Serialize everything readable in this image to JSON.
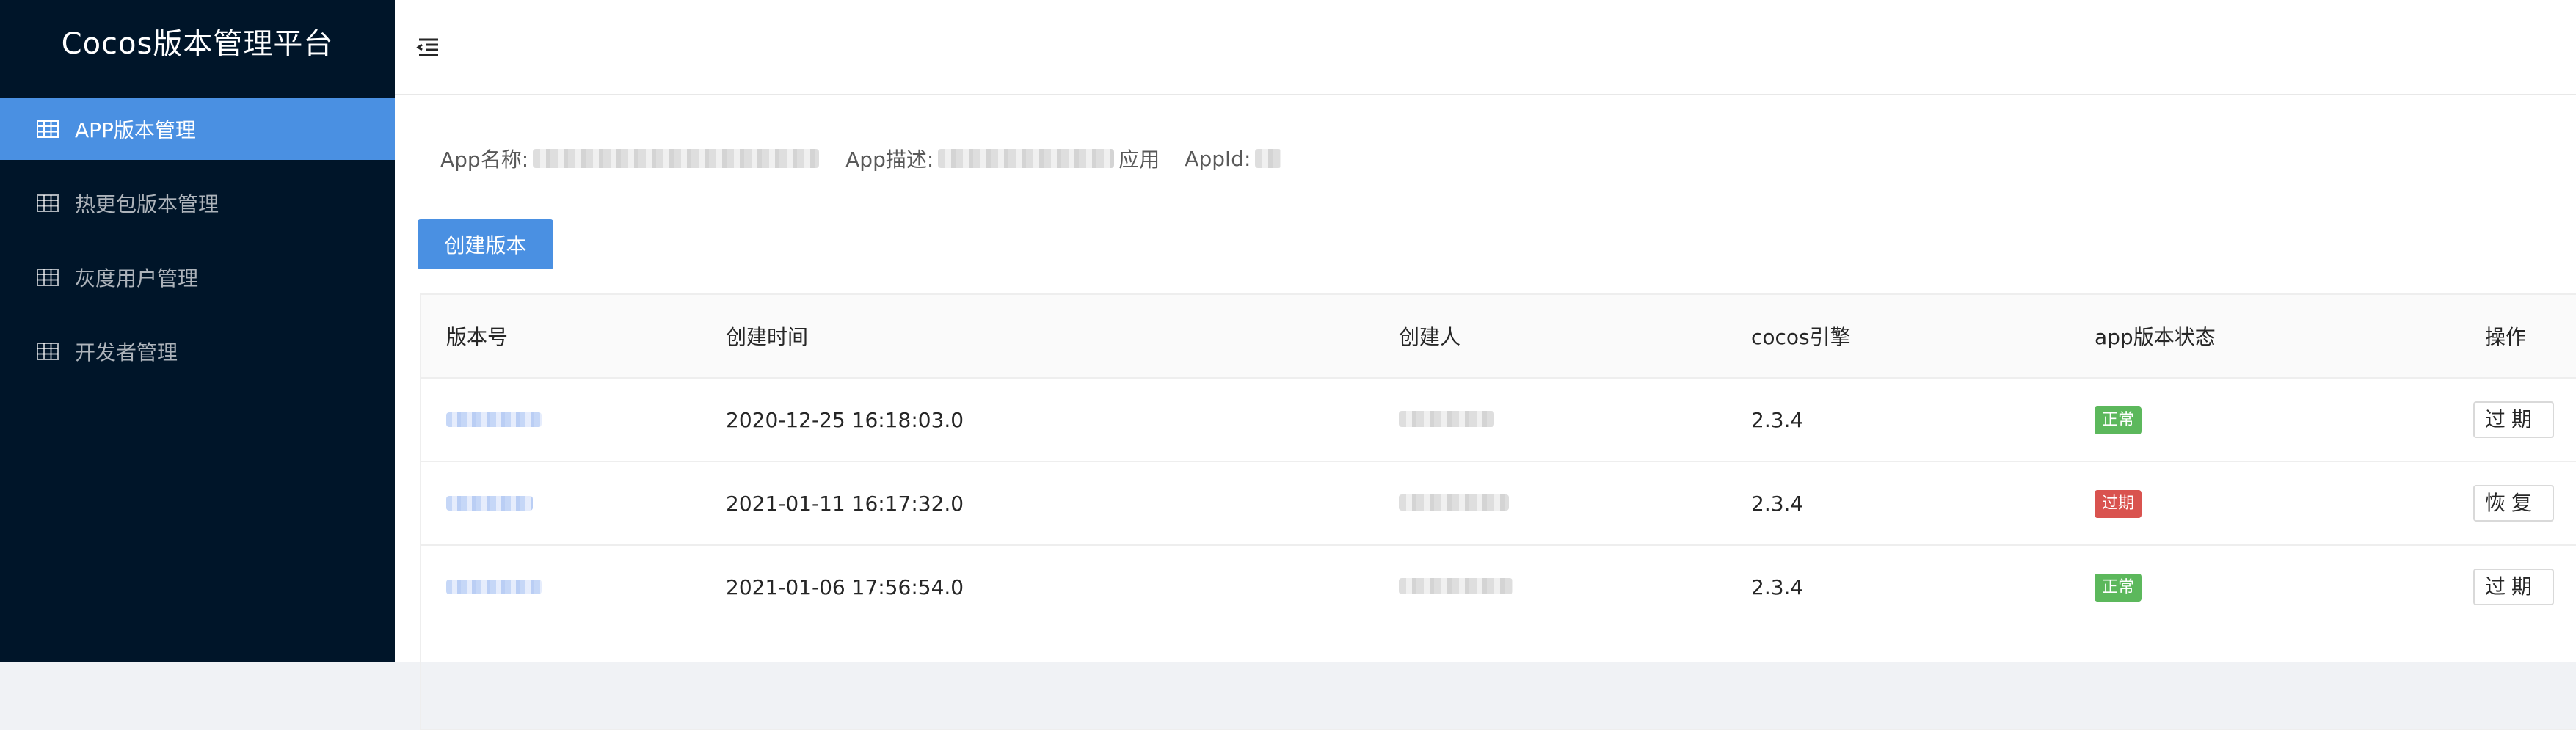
{
  "sidebar": {
    "title": "Cocos版本管理平台",
    "items": [
      {
        "label": "APP版本管理",
        "active": true
      },
      {
        "label": "热更包版本管理",
        "active": false
      },
      {
        "label": "灰度用户管理",
        "active": false
      },
      {
        "label": "开发者管理",
        "active": false
      }
    ]
  },
  "info": {
    "app_name_label": "App名称:",
    "app_desc_label": "App描述:",
    "app_desc_suffix": "应用",
    "app_id_label": "AppId:"
  },
  "actions": {
    "create_label": "创建版本"
  },
  "table": {
    "headers": [
      "版本号",
      "创建时间",
      "创建人",
      "cocos引擎",
      "app版本状态",
      "操作"
    ],
    "rows": [
      {
        "created_at": "2020-12-25 16:18:03.0",
        "engine": "2.3.4",
        "status": "正常",
        "action": "过期"
      },
      {
        "created_at": "2021-01-11 16:17:32.0",
        "engine": "2.3.4",
        "status": "过期",
        "action": "恢复"
      },
      {
        "created_at": "2021-01-06 17:56:54.0",
        "engine": "2.3.4",
        "status": "正常",
        "action": "过期"
      }
    ]
  },
  "colors": {
    "sidebar_bg": "#001529",
    "accent": "#4a90e2",
    "status_normal": "#5cb85c",
    "status_expired": "#d9534f"
  }
}
